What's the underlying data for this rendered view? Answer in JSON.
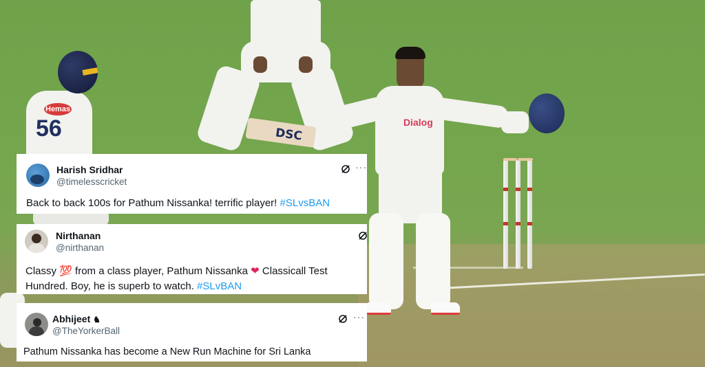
{
  "scene": {
    "description_labels": {
      "bat_brand": "DSC",
      "jersey_sponsor": "Dialog",
      "left_player_sponsor": "Hemas",
      "left_player_number": "56"
    }
  },
  "tweets": [
    {
      "name": "Harish Sridhar",
      "handle": "@timelesscricket",
      "text_plain": "Back to back 100s for Pathum Nissanka! terrific player! ",
      "hashtag": "#SLvsBAN",
      "icons": [
        "grok-icon",
        "more-icon"
      ]
    },
    {
      "name": "Nirthanan",
      "handle": "@nirthanan",
      "text_a": "Classy ",
      "emoji_100": "💯",
      "text_b": " from a class player, Pathum Nissanka ",
      "emoji_heart": "❤",
      "text_c": " Classicall Test",
      "text_line2": "Hundred. Boy, he is superb to watch. ",
      "hashtag": "#SLvBAN",
      "icons": [
        "grok-icon"
      ]
    },
    {
      "name": "Abhijeet",
      "name_badge": "♞",
      "handle": "@TheYorkerBall",
      "text_plain": "Pathum Nissanka has become a New Run Machine for Sri Lanka",
      "icons": [
        "grok-icon",
        "more-icon"
      ]
    }
  ],
  "colors": {
    "hashtag": "#1d9bf0",
    "heart": "#e0245e",
    "text": "#0f1419",
    "handle": "#536471"
  }
}
